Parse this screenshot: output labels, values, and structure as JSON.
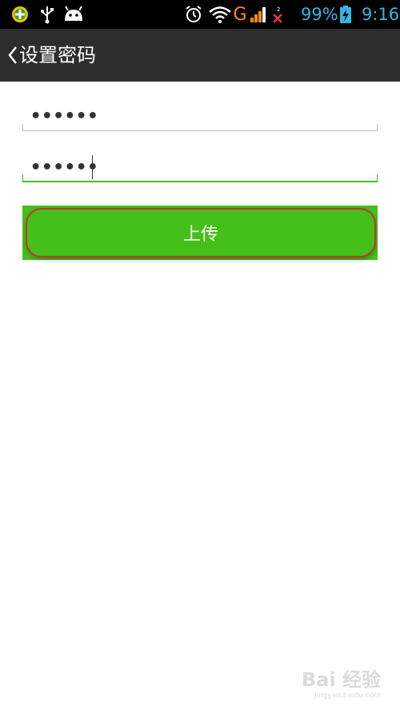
{
  "status_bar": {
    "battery_percent": "99%",
    "time": "9:16",
    "icons": [
      "app-notification-icon",
      "usb-icon",
      "android-debug-icon",
      "alarm-icon",
      "wifi-icon",
      "mobile-data-g-icon",
      "signal-icon",
      "sim2-no-signal-icon",
      "battery-charging-icon"
    ],
    "accent_color": "#33b5e5"
  },
  "title_bar": {
    "title": "设置密码",
    "back_icon": "chevron-left-icon"
  },
  "form": {
    "password_value": "••••••",
    "confirm_password_value": "••••••",
    "upload_label": "上传",
    "button_color": "#45c01a"
  },
  "watermark": {
    "main": "Bai 经验",
    "sub": "jingyan.baidu.com"
  }
}
